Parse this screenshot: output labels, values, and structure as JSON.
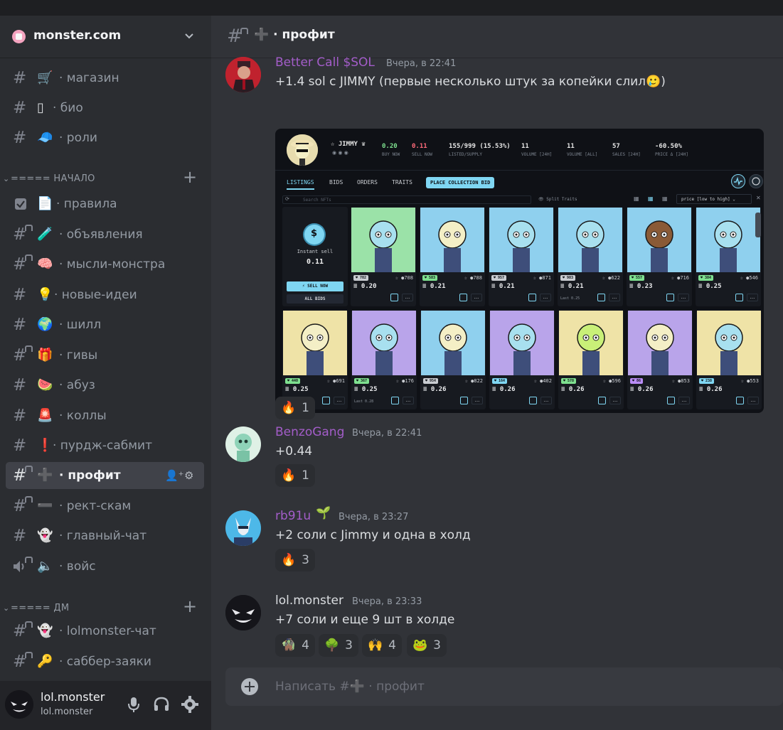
{
  "server": {
    "name": "monster.com"
  },
  "channels_top": [
    {
      "emoji": "🛒",
      "label": "· магазин"
    },
    {
      "emoji": "▯",
      "label": "· био"
    },
    {
      "emoji": "🧢",
      "label": "· роли"
    }
  ],
  "category_start": {
    "label": "===== НАЧАЛО"
  },
  "channels_start": [
    {
      "emoji": "📄",
      "label": "· правила"
    },
    {
      "emoji": "🧪",
      "label": "· объявления"
    },
    {
      "emoji": "🧠",
      "label": "· мысли-монстра"
    },
    {
      "emoji": "💡",
      "label": "· новые-идеи"
    },
    {
      "emoji": "🌍",
      "label": "· шилл"
    },
    {
      "emoji": "🎁",
      "label": "· гивы"
    },
    {
      "emoji": "🍉",
      "label": "· абуз"
    },
    {
      "emoji": "🚨",
      "label": "· коллы"
    },
    {
      "emoji": "❗",
      "label": "· пурдж-сабмит"
    },
    {
      "emoji": "➕",
      "label": "· профит"
    },
    {
      "emoji": "➖",
      "label": "· рект-скам"
    },
    {
      "emoji": "👻",
      "label": "· главный-чат"
    },
    {
      "emoji": "🔈",
      "label": "· войс"
    }
  ],
  "category_dm": {
    "label": "===== ДМ"
  },
  "channels_dm": [
    {
      "emoji": "👻",
      "label": "· lolmonster-чат"
    },
    {
      "emoji": "🔑",
      "label": "· саббер-заяки"
    }
  ],
  "user": {
    "name": "lol.monster",
    "sub": "lol.monster"
  },
  "header": {
    "emoji": "➕",
    "title": "· профит"
  },
  "messages": [
    {
      "author": "Better Call $SOL",
      "time": "Вчера, в 22:41",
      "text": "+1.4 sol с JIMMY (первые несколько штук за копейки слил",
      "emoji_after": "🥲",
      "close": ")",
      "reactions": [
        {
          "emoji": "🔥",
          "count": "1"
        }
      ]
    },
    {
      "author": "BenzoGang",
      "time": "Вчера, в 22:41",
      "text": "+0.44",
      "reactions": [
        {
          "emoji": "🔥",
          "count": "1"
        }
      ]
    },
    {
      "author": "rb91u",
      "time": "Вчера, в 23:27",
      "text": "+2 соли с Jimmy и одна в холд",
      "reactions": [
        {
          "emoji": "🔥",
          "count": "3"
        }
      ]
    },
    {
      "author": "lol.monster",
      "time": "Вчера, в 23:33",
      "text": "+7 соли и еще 9 шт в холде",
      "reactions": [
        {
          "emoji": "🧌",
          "count": "4"
        },
        {
          "emoji": "🌳",
          "count": "3"
        },
        {
          "emoji": "🙌",
          "count": "4"
        },
        {
          "emoji": "🐸",
          "count": "3"
        }
      ]
    }
  ],
  "embed": {
    "collection": "JIMMY",
    "stats": [
      {
        "value": "0.20",
        "label": "BUY NOW",
        "color": "#7ee08f"
      },
      {
        "value": "0.11",
        "label": "SELL NOW",
        "color": "#ff6b7a"
      },
      {
        "value": "155/999 (15.53%)",
        "label": "LISTED/SUPPLY",
        "color": "#e6e6e6"
      },
      {
        "value": "11",
        "label": "VOLUME [24H]",
        "color": "#e6e6e6"
      },
      {
        "value": "11",
        "label": "VOLUME [ALL]",
        "color": "#e6e6e6"
      },
      {
        "value": "57",
        "label": "SALES [24H]",
        "color": "#e6e6e6"
      },
      {
        "value": "-60.50%",
        "label": "PRICE Δ [24H]",
        "color": "#e6e6e6"
      }
    ],
    "tabs": [
      "LISTINGS",
      "BIDS",
      "ORDERS",
      "TRAITS"
    ],
    "place_bid": "PLACE COLLECTION BID",
    "search_placeholder": "Search NFTs",
    "split_traits": "Split Traits",
    "sort": "price [low to high]",
    "sell": {
      "title": "Instant sell",
      "value": "0.11",
      "sell_btn": "⚡ SELL NOW",
      "bids_btn": "ALL BIDS"
    },
    "nfts": [
      {
        "bg": "#9be2a8",
        "face": "#a8e0ef",
        "badge": "702",
        "badge_color": "#c9ccd1",
        "num": "●708",
        "price": "≡ 0.20",
        "last": ""
      },
      {
        "bg": "#8fd0ee",
        "face": "#f4efc6",
        "badge": "583",
        "badge_color": "#7ee08f",
        "num": "●788",
        "price": "≡ 0.21",
        "last": ""
      },
      {
        "bg": "#8fd0ee",
        "face": "#a8e0ef",
        "badge": "957",
        "badge_color": "#c9ccd1",
        "num": "●871",
        "price": "≡ 0.21",
        "last": ""
      },
      {
        "bg": "#8fd0ee",
        "face": "#a8e0ef",
        "badge": "983",
        "badge_color": "#c9ccd1",
        "num": "●622",
        "price": "≡ 0.21",
        "last": "Last 0.25"
      },
      {
        "bg": "#8fd0ee",
        "face": "#8a5a36",
        "badge": "557",
        "badge_color": "#7ee08f",
        "num": "●716",
        "price": "≡ 0.23",
        "last": ""
      },
      {
        "bg": "#8fd0ee",
        "face": "#a8e0ef",
        "badge": "384",
        "badge_color": "#7ee08f",
        "num": "●546",
        "price": "≡ 0.25",
        "last": ""
      },
      {
        "bg": "#efe3a7",
        "face": "#f4efc6",
        "badge": "440",
        "badge_color": "#7ee08f",
        "num": "●691",
        "price": "≡ 0.25",
        "last": ""
      },
      {
        "bg": "#b9a4ea",
        "face": "#a8e0ef",
        "badge": "367",
        "badge_color": "#7ee08f",
        "num": "●176",
        "price": "≡ 0.25",
        "last": "Last 0.28"
      },
      {
        "bg": "#8fd0ee",
        "face": "#f4efc6",
        "badge": "954",
        "badge_color": "#c9ccd1",
        "num": "●822",
        "price": "≡ 0.26",
        "last": ""
      },
      {
        "bg": "#b9a4ea",
        "face": "#a8e0ef",
        "badge": "164",
        "badge_color": "#7fd6f2",
        "num": "●402",
        "price": "≡ 0.26",
        "last": ""
      },
      {
        "bg": "#efe3a7",
        "face": "#c9f078",
        "badge": "578",
        "badge_color": "#7ee08f",
        "num": "●596",
        "price": "≡ 0.26",
        "last": ""
      },
      {
        "bg": "#b9a4ea",
        "face": "#f4efc6",
        "badge": "86",
        "badge_color": "#b98cf5",
        "num": "●853",
        "price": "≡ 0.26",
        "last": ""
      },
      {
        "bg": "#efe3a7",
        "face": "#a8e0ef",
        "badge": "238",
        "badge_color": "#7fd6f2",
        "num": "●553",
        "price": "≡ 0.26",
        "last": ""
      }
    ]
  },
  "composer": {
    "placeholder": "Написать #➕ · профит"
  },
  "colors": {
    "author_bcs": "#a35dc9",
    "author_benzo": "#a35dc9",
    "author_rb91u": "#a35dc9",
    "author_lol": "#dbdee1"
  }
}
